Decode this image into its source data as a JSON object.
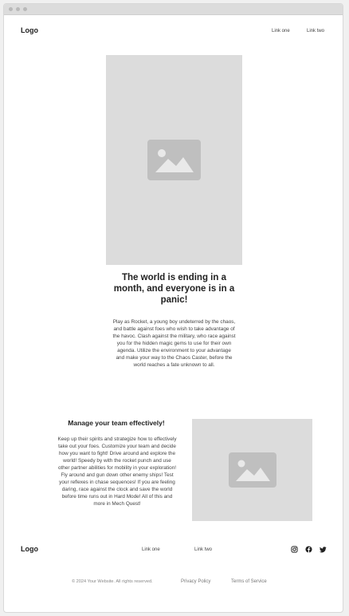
{
  "nav": {
    "logo": "Logo",
    "links": [
      "Link one",
      "Link two"
    ]
  },
  "hero": {
    "image_icon": "image-placeholder-icon",
    "heading": "The world is ending in a month, and everyone is in a panic!",
    "text": "Play as Rocket, a young boy undeterred by the chaos, and battle against foes who wish to take advantage of the havoc. Clash against the military, who race against you for the hidden magic gems to use for their own agenda. Utilize the environment to your advantage and make your way to the Chaos Caster, before the world reaches a fate unknown to all."
  },
  "feature": {
    "title": "Manage your team effectively!",
    "text": "Keep up their spirits and strategize how to effectively take out your foes. Customize your team and decide how you want to fight! Drive around and explore the world! Speedy by with the rocket punch and use other partner abilities for mobility in your exploration! Fly around and gun down other enemy ships! Test your reflexes in chase sequences! If you are feeling daring, race against the clock and save the world before time runs out in Hard Mode! All of this and more in Mech Quest!",
    "image_icon": "image-placeholder-icon"
  },
  "footer": {
    "logo": "Logo",
    "links": [
      "Link one",
      "Link two"
    ],
    "social_icons": [
      "instagram-icon",
      "facebook-icon",
      "twitter-icon"
    ],
    "copyright": "© 2024 Your Website. All rights reserved.",
    "privacy": "Privacy Policy",
    "terms": "Terms of Service"
  },
  "colors": {
    "placeholder_bg": "#dcdcdc",
    "placeholder_icon": "#bfbfbf",
    "text": "#333333"
  }
}
